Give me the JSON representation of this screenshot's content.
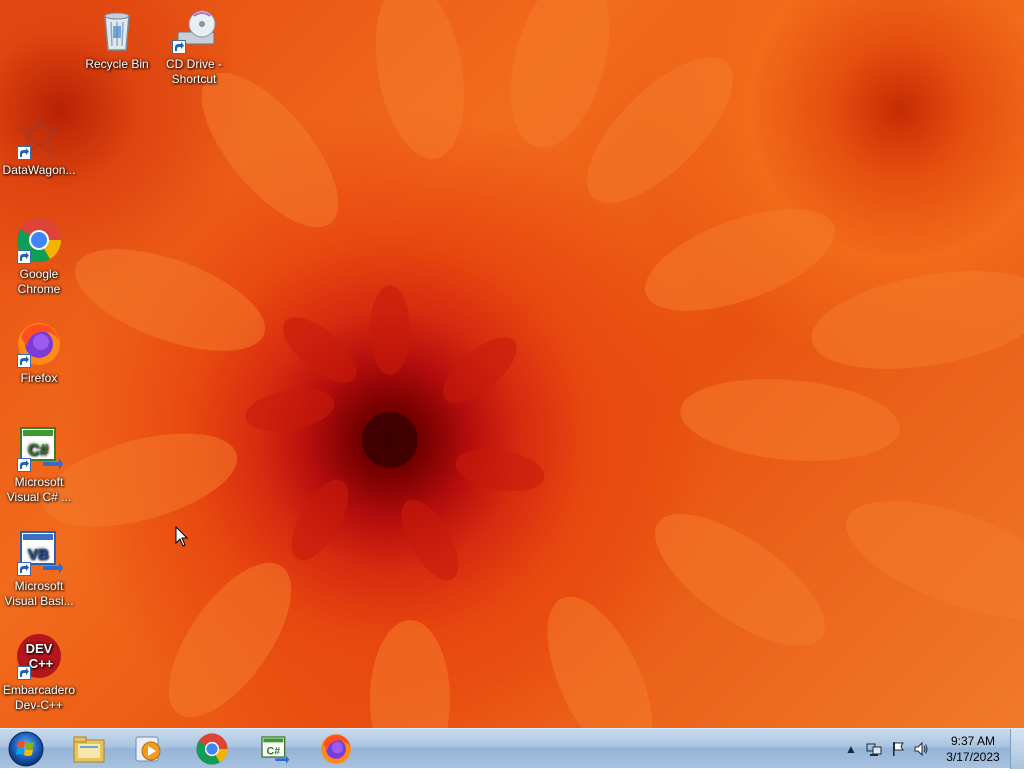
{
  "desktop": {
    "icons": [
      {
        "label": "Recycle Bin"
      },
      {
        "label": "CD Drive -\nShortcut"
      },
      {
        "label": "DataWagon..."
      },
      {
        "label": "Google\nChrome"
      },
      {
        "label": "Firefox"
      },
      {
        "label": "Microsoft\nVisual C# ..."
      },
      {
        "label": "Microsoft\nVisual Basi..."
      },
      {
        "label": "Embarcadero\nDev-C++"
      }
    ]
  },
  "taskbar": {
    "start_icon": "windows-logo-icon",
    "pinned": [
      {
        "icon": "file-explorer-icon"
      },
      {
        "icon": "media-player-icon"
      },
      {
        "icon": "chrome-icon"
      },
      {
        "icon": "visual-csharp-icon"
      },
      {
        "icon": "firefox-icon"
      }
    ],
    "tray": {
      "icons": [
        "show-hidden-icons-icon",
        "network-icon",
        "action-center-flag-icon",
        "volume-icon"
      ],
      "time": "9:37 AM",
      "date": "3/17/2023"
    }
  },
  "colors": {
    "wallpaper_primary": "#e8520f",
    "wallpaper_center": "#7a0000",
    "taskbar": "#a9c4e0"
  }
}
